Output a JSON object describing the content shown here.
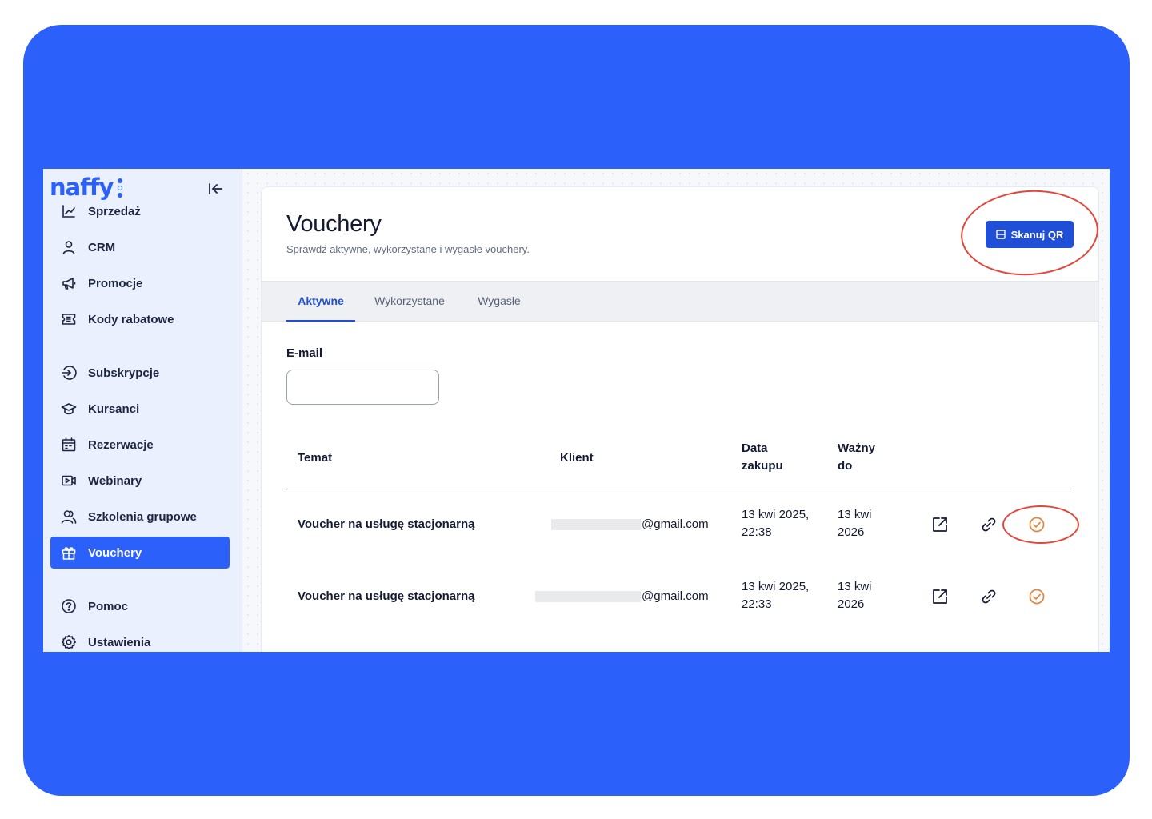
{
  "brand": {
    "logo_text": "naffy",
    "accent": "#2b60fa",
    "highlight": "#e2473a",
    "confirm_color": "#e8843a"
  },
  "sidebar": {
    "collapse_icon": "collapse-left-icon",
    "items": [
      {
        "label": "Sprzedaż",
        "icon": "chart-icon"
      },
      {
        "label": "CRM",
        "icon": "user-icon"
      },
      {
        "label": "Promocje",
        "icon": "megaphone-icon"
      },
      {
        "label": "Kody rabatowe",
        "icon": "ticket-icon"
      },
      {
        "label": "Subskrypcje",
        "icon": "subscription-icon"
      },
      {
        "label": "Kursanci",
        "icon": "graduation-cap-icon"
      },
      {
        "label": "Rezerwacje",
        "icon": "calendar-icon"
      },
      {
        "label": "Webinary",
        "icon": "video-icon"
      },
      {
        "label": "Szkolenia grupowe",
        "icon": "users-icon"
      },
      {
        "label": "Vouchery",
        "icon": "gift-icon",
        "active": true
      },
      {
        "label": "Pomoc",
        "icon": "help-icon"
      },
      {
        "label": "Ustawienia",
        "icon": "gear-icon"
      }
    ]
  },
  "page": {
    "title": "Vouchery",
    "subtitle": "Sprawdź aktywne, wykorzystane i wygasłe vouchery.",
    "scan_button": "Skanuj QR"
  },
  "tabs": [
    {
      "label": "Aktywne",
      "active": true
    },
    {
      "label": "Wykorzystane"
    },
    {
      "label": "Wygasłe"
    }
  ],
  "filter": {
    "email_label": "E-mail",
    "email_value": "",
    "email_placeholder": ""
  },
  "table": {
    "headers": {
      "topic": "Temat",
      "client": "Klient",
      "purchase_1": "Data",
      "purchase_2": "zakupu",
      "valid_1": "Ważny",
      "valid_2": "do"
    },
    "rows": [
      {
        "topic": "Voucher na usługę stacjonarną",
        "client": "@gmail.com",
        "purchase_1": "13 kwi 2025,",
        "purchase_2": "22:38",
        "valid_1": "13 kwi",
        "valid_2": "2026"
      },
      {
        "topic": "Voucher na usługę stacjonarną",
        "client": "@gmail.com",
        "purchase_1": "13 kwi 2025,",
        "purchase_2": "22:33",
        "valid_1": "13 kwi",
        "valid_2": "2026"
      }
    ],
    "row_actions": [
      "external-link-icon",
      "link-icon",
      "check-circle-icon"
    ]
  }
}
